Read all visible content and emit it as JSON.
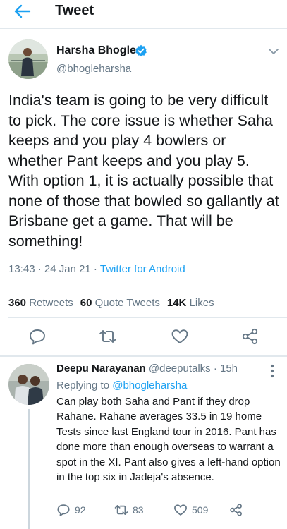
{
  "header": {
    "title": "Tweet"
  },
  "tweet": {
    "author_name": "Harsha Bhogle",
    "author_handle": "@bhogleharsha",
    "text": "India's team is going to be very difficult to pick. The core issue is whether Saha keeps and you play 4 bowlers or whether Pant keeps and you play 5. With option 1, it is actually possible that none of those that bowled so gallantly at Brisbane get a game. That will be something!",
    "time": "13:43 · 24 Jan 21 · ",
    "source": "Twitter for Android",
    "stats": {
      "retweets_count": "360",
      "retweets_label": "Retweets",
      "quotes_count": "60",
      "quotes_label": "Quote Tweets",
      "likes_count": "14K",
      "likes_label": "Likes"
    }
  },
  "reply": {
    "author_name": "Deepu Narayanan",
    "author_handle": "@deeputalks",
    "time": " · 15h",
    "replying_label": "Replying to ",
    "replying_to": "@bhogleharsha",
    "text": "Can play both Saha and Pant if they drop Rahane. Rahane averages 33.5 in 19 home Tests since last England tour in 2016. Pant has done more than enough overseas to warrant a spot in the XI. Pant also gives a left-hand option in the top six in Jadeja's absence.",
    "replies": "92",
    "retweets": "83",
    "likes": "509"
  },
  "colors": {
    "accent": "#1da1f2",
    "muted": "#657786",
    "divider": "#e1e8ed"
  },
  "icons": [
    "back-arrow-icon",
    "verified-badge-icon",
    "chevron-down-icon",
    "reply-icon",
    "retweet-icon",
    "like-icon",
    "share-icon",
    "more-vertical-icon"
  ]
}
